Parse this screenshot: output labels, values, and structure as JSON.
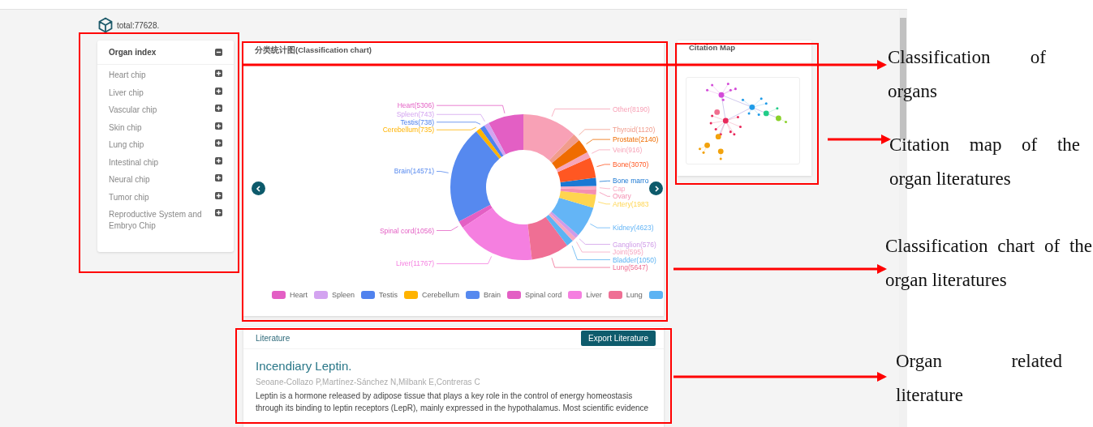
{
  "header": {
    "total": "total:77628."
  },
  "organ_index": {
    "title": "Organ index",
    "expanded": true,
    "items": [
      {
        "label": "Heart chip",
        "expanded": false
      },
      {
        "label": "Liver chip",
        "expanded": false
      },
      {
        "label": "Vascular chip",
        "expanded": false
      },
      {
        "label": "Skin chip",
        "expanded": false
      },
      {
        "label": "Lung chip",
        "expanded": false
      },
      {
        "label": "Intestinal chip",
        "expanded": false
      },
      {
        "label": "Neural chip",
        "expanded": false
      },
      {
        "label": "Tumor chip",
        "expanded": false
      },
      {
        "label": "Reproductive System and Embryo Chip",
        "expanded": false
      }
    ]
  },
  "classification": {
    "title": "分类统计图(Classification chart)",
    "chart_data": {
      "type": "donut",
      "categories": [
        "Heart(5306)",
        "Spleen(743)",
        "Testis(738)",
        "Cerebellum(735)",
        "Brain(14571)",
        "Spinal cord(1056)",
        "Liver(11767)",
        "Lung(5647)",
        "Bladder(1050)",
        "Joint(595)",
        "Ganglion(576)",
        "Kidney(4623)",
        "Artery(1983",
        "Ovary",
        "Cap",
        "Bone marro",
        "Bone(3070)",
        "Vein(916)",
        "Prostate(2140)",
        "Thyroid(1120)",
        "Other(8190)"
      ],
      "series": [
        {
          "colors": [
            "#e35fc4",
            "#d3a3f0",
            "#5082ee",
            "#ffb300",
            "#5689ef",
            "#e35fc4",
            "#f57fe0",
            "#ef6f94",
            "#5cb3f3",
            "#f6a7c1",
            "#cf9be8",
            "#64b5f6",
            "#ffd54f",
            "#f48fb1",
            "#f9a9c3",
            "#1b78d3",
            "#ff5722",
            "#f7a5b9",
            "#ef6c00",
            "#f19c8c",
            "#f8a1b6"
          ],
          "values": [
            5306,
            743,
            738,
            735,
            14571,
            1056,
            11767,
            5647,
            1050,
            595,
            576,
            4623,
            1983,
            740,
            550,
            1200,
            3070,
            916,
            2140,
            1120,
            8190
          ]
        }
      ]
    },
    "legend": [
      {
        "label": "Heart",
        "color": "#e35fc4"
      },
      {
        "label": "Spleen",
        "color": "#d3a3f0"
      },
      {
        "label": "Testis",
        "color": "#5082ee"
      },
      {
        "label": "Cerebellum",
        "color": "#ffb300"
      },
      {
        "label": "Brain",
        "color": "#5689ef"
      },
      {
        "label": "Spinal cord",
        "color": "#e35fc4"
      },
      {
        "label": "Liver",
        "color": "#f57fe0"
      },
      {
        "label": "Lung",
        "color": "#ef6f94"
      },
      {
        "color": "#5cb3f3"
      }
    ]
  },
  "citation_map": {
    "title": "Citation Map"
  },
  "literature": {
    "title": "Literature",
    "export_button": "Export Literature",
    "article": {
      "title": "Incendiary Leptin.",
      "authors": "Seoane-Collazo P,Martínez-Sánchez N,Milbank E,Contreras C",
      "abstract": "Leptin is a hormone released by adipose tissue that plays a key role in the control of energy homeostasis through its binding to leptin receptors (LepR), mainly expressed in the hypothalamus. Most scientific evidence"
    }
  },
  "annotations": [
    {
      "text": "Classification of organs"
    },
    {
      "text": "Citation map of the organ literatures"
    },
    {
      "text": "Classification chart of the organ literatures"
    },
    {
      "text": "Organ related literature"
    }
  ]
}
